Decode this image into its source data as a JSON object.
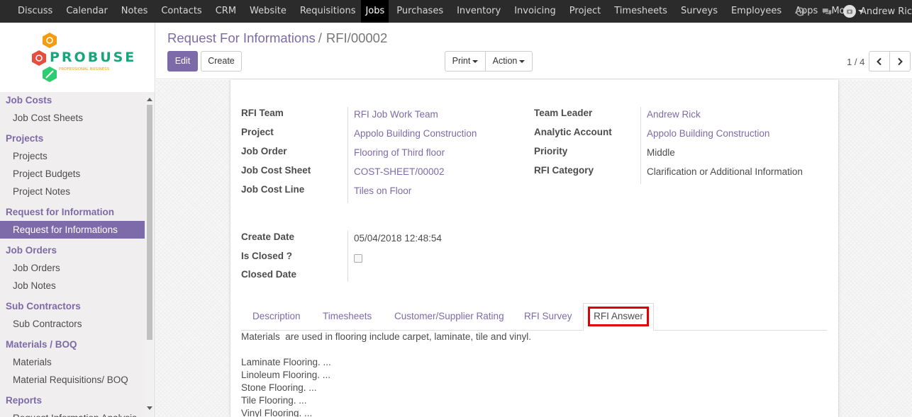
{
  "topnav": {
    "items": [
      "Discuss",
      "Calendar",
      "Notes",
      "Contacts",
      "CRM",
      "Website",
      "Requisitions",
      "Jobs",
      "Purchases",
      "Inventory",
      "Invoicing",
      "Project",
      "Timesheets",
      "Surveys",
      "Employees",
      "Apps"
    ],
    "active": "Jobs",
    "more_label": "More",
    "user_name": "Andrew Ric",
    "icons": [
      "clock-icon",
      "chat-icon"
    ]
  },
  "sidebar": {
    "logo_text": "PROBUSE",
    "logo_tagline": "PROFESSIONAL BUSINESS",
    "sections": [
      {
        "title": "Job Costs",
        "items": [
          "Job Cost Sheets"
        ]
      },
      {
        "title": "Projects",
        "items": [
          "Projects",
          "Project Budgets",
          "Project Notes"
        ]
      },
      {
        "title": "Request for Information",
        "items": [
          "Request for Informations"
        ]
      },
      {
        "title": "Job Orders",
        "items": [
          "Job Orders",
          "Job Notes"
        ]
      },
      {
        "title": "Sub Contractors",
        "items": [
          "Sub Contractors"
        ]
      },
      {
        "title": "Materials / BOQ",
        "items": [
          "Materials",
          "Material Requisitions/ BOQ"
        ]
      },
      {
        "title": "Reports",
        "items": [
          "Request Information Analysis"
        ]
      }
    ],
    "active_item": "Request for Informations"
  },
  "control_panel": {
    "breadcrumb_parent": "Request For Informations",
    "breadcrumb_separator": "/",
    "breadcrumb_current": "RFI/00002",
    "edit_label": "Edit",
    "create_label": "Create",
    "print_label": "Print",
    "action_label": "Action",
    "pager": "1 / 4"
  },
  "form": {
    "left": [
      {
        "label": "RFI Team",
        "value": "RFI Job Work Team",
        "link": true
      },
      {
        "label": "Project",
        "value": "Appolo Building Construction",
        "link": true
      },
      {
        "label": "Job Order",
        "value": "Flooring of Third floor",
        "link": true
      },
      {
        "label": "Job Cost Sheet",
        "value": "COST-SHEET/00002",
        "link": true
      },
      {
        "label": "Job Cost Line",
        "value": "Tiles on Floor",
        "link": true
      }
    ],
    "right": [
      {
        "label": "Team Leader",
        "value": "Andrew Rick",
        "link": true
      },
      {
        "label": "Analytic Account",
        "value": "Appolo Building Construction",
        "link": true
      },
      {
        "label": "Priority",
        "value": "Middle",
        "link": false
      },
      {
        "label": "RFI Category",
        "value": "Clarification or Additional Information",
        "link": false
      }
    ],
    "dates": {
      "create_date_label": "Create Date",
      "create_date_value": "05/04/2018 12:48:54",
      "is_closed_label": "Is Closed ?",
      "is_closed_value": false,
      "closed_date_label": "Closed Date",
      "closed_date_value": ""
    }
  },
  "tabs": {
    "items": [
      "Description",
      "Timesheets",
      "Customer/Supplier Rating",
      "RFI Survey",
      "RFI Answer"
    ],
    "active": "RFI Answer"
  },
  "answer_lines": [
    "Materials  are used in flooring include carpet, laminate, tile and vinyl.",
    "",
    "Laminate Flooring. ...",
    "Linoleum Flooring. ...",
    "Stone Flooring. ...",
    "Tile Flooring. ...",
    "Vinyl Flooring. ..."
  ],
  "colors": {
    "brand": "#7c6ba8",
    "topbar": "#2b2b2b",
    "highlight": "#e00000"
  }
}
